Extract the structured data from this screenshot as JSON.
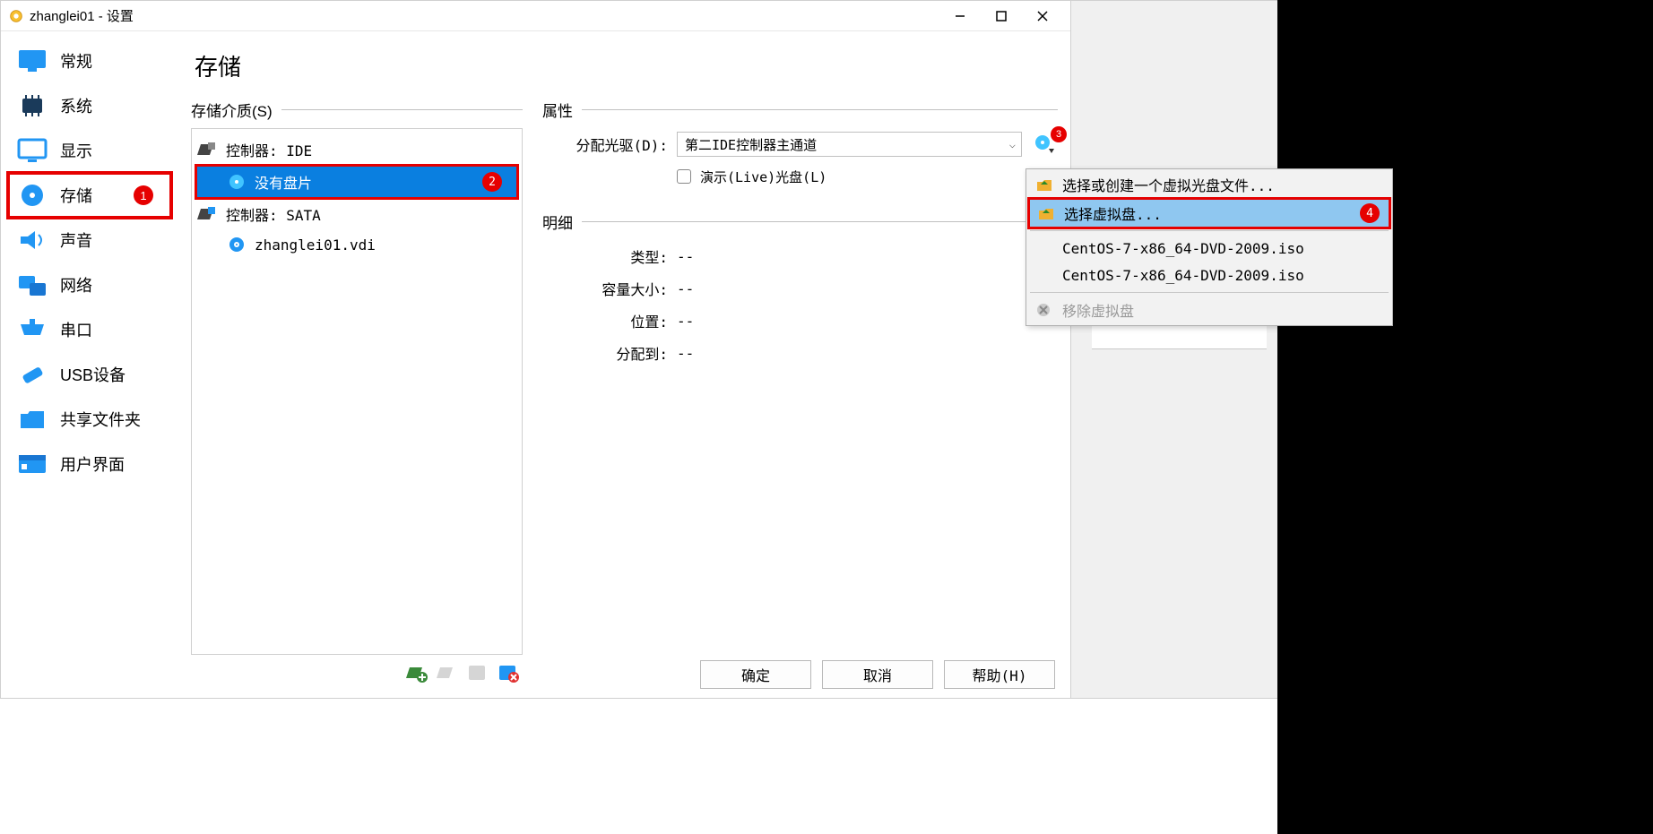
{
  "window": {
    "title": "zhanglei01 - 设置"
  },
  "sidebar": {
    "items": [
      {
        "label": "常规"
      },
      {
        "label": "系统"
      },
      {
        "label": "显示"
      },
      {
        "label": "存储"
      },
      {
        "label": "声音"
      },
      {
        "label": "网络"
      },
      {
        "label": "串口"
      },
      {
        "label": "USB设备"
      },
      {
        "label": "共享文件夹"
      },
      {
        "label": "用户界面"
      }
    ]
  },
  "page": {
    "title": "存储"
  },
  "storage": {
    "media_label": "存储介质(S)",
    "controllers": [
      {
        "label": "控制器: IDE",
        "children": [
          {
            "label": "没有盘片"
          }
        ]
      },
      {
        "label": "控制器: SATA",
        "children": [
          {
            "label": "zhanglei01.vdi"
          }
        ]
      }
    ]
  },
  "attributes": {
    "section_label": "属性",
    "optical_label": "分配光驱(D):",
    "optical_value": "第二IDE控制器主通道",
    "live_label": "演示(Live)光盘(L)"
  },
  "details": {
    "section_label": "明细",
    "rows": [
      {
        "label": "类型:",
        "value": "--"
      },
      {
        "label": "容量大小:",
        "value": "--"
      },
      {
        "label": "位置:",
        "value": "--"
      },
      {
        "label": "分配到:",
        "value": "--"
      }
    ]
  },
  "footer": {
    "ok": "确定",
    "cancel": "取消",
    "help": "帮助(H)"
  },
  "menu": {
    "items": [
      {
        "label": "选择或创建一个虚拟光盘文件...",
        "icon": "folder"
      },
      {
        "label": "选择虚拟盘...",
        "icon": "folder"
      },
      {
        "label": "CentOS-7-x86_64-DVD-2009.iso"
      },
      {
        "label": "CentOS-7-x86_64-DVD-2009.iso"
      },
      {
        "label": "移除虚拟盘",
        "disabled": true,
        "icon": "remove"
      }
    ]
  },
  "badges": {
    "b1": "1",
    "b2": "2",
    "b3": "3",
    "b4": "4"
  }
}
